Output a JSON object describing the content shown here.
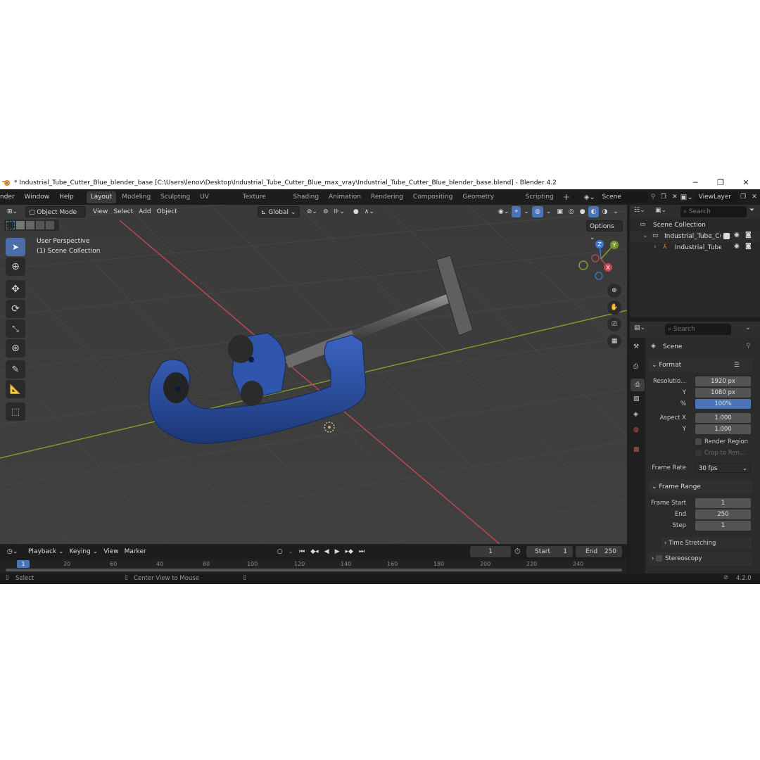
{
  "window": {
    "title": "* Industrial_Tube_Cutter_Blue_blender_base [C:\\Users\\lenov\\Desktop\\Industrial_Tube_Cutter_Blue_max_vray\\Industrial_Tube_Cutter_Blue_blender_base.blend] - Blender 4.2",
    "minimize": "─",
    "maximize": "❐",
    "close": "✕"
  },
  "menu": [
    "nder",
    "Window",
    "Help"
  ],
  "workspaces": [
    {
      "label": "Layout",
      "active": true
    },
    {
      "label": "Modeling"
    },
    {
      "label": "Sculpting"
    },
    {
      "label": "UV Editing"
    },
    {
      "label": "Texture Paint"
    },
    {
      "label": "Shading"
    },
    {
      "label": "Animation"
    },
    {
      "label": "Rendering"
    },
    {
      "label": "Compositing"
    },
    {
      "label": "Geometry Nodes"
    },
    {
      "label": "Scripting"
    }
  ],
  "add_workspace": "+",
  "scene_field": "Scene",
  "viewlayer_field": "ViewLayer",
  "viewport": {
    "mode": "Object Mode",
    "menus": [
      "View",
      "Select",
      "Add",
      "Object"
    ],
    "orientation": "Global",
    "options": "Options",
    "perspective": "User Perspective",
    "collection": "(1) Scene Collection",
    "gizmo": {
      "z": "Z",
      "y": "Y",
      "x": "X"
    }
  },
  "outliner": {
    "search_placeholder": "Search",
    "root": "Scene Collection",
    "items": [
      {
        "label": "Industrial_Tube_Cu"
      },
      {
        "label": "Industrial_Tube"
      }
    ]
  },
  "properties": {
    "search_placeholder": "Search",
    "context": "Scene",
    "format_header": "Format",
    "resolution_label": "Resolutio...",
    "res_x": "1920 px",
    "y_label": "Y",
    "res_y": "1080 px",
    "pct_label": "%",
    "res_pct": "100%",
    "aspect_label": "Aspect X",
    "aspect_x": "1.000",
    "aspect_y_label": "Y",
    "aspect_y": "1.000",
    "render_region": "Render Region",
    "crop": "Crop to Ren...",
    "frame_rate_label": "Frame Rate",
    "frame_rate": "30 fps",
    "frame_range_header": "Frame Range",
    "frame_start_label": "Frame Start",
    "frame_start": "1",
    "end_label": "End",
    "frame_end": "250",
    "step_label": "Step",
    "frame_step": "1",
    "time_stretching": "Time Stretching",
    "stereoscopy": "Stereoscopy"
  },
  "timeline": {
    "menus": [
      "Playback",
      "Keying",
      "View",
      "Marker"
    ],
    "current_frame": "1",
    "start_label": "Start",
    "start": "1",
    "end_label": "End",
    "end": "250",
    "ticks": [
      "1",
      "20",
      "60",
      "40",
      "80",
      "100",
      "120",
      "140",
      "160",
      "180",
      "200",
      "220",
      "240"
    ]
  },
  "status": {
    "select": "Select",
    "center": "Center View to Mouse",
    "version": "4.2.0"
  },
  "colors": {
    "accent": "#4a73b8",
    "tool_blue": "#2f4f8a",
    "x_axis": "#c8474e",
    "y_axis": "#7fa02a",
    "object_blue": "#2c4f9e"
  }
}
